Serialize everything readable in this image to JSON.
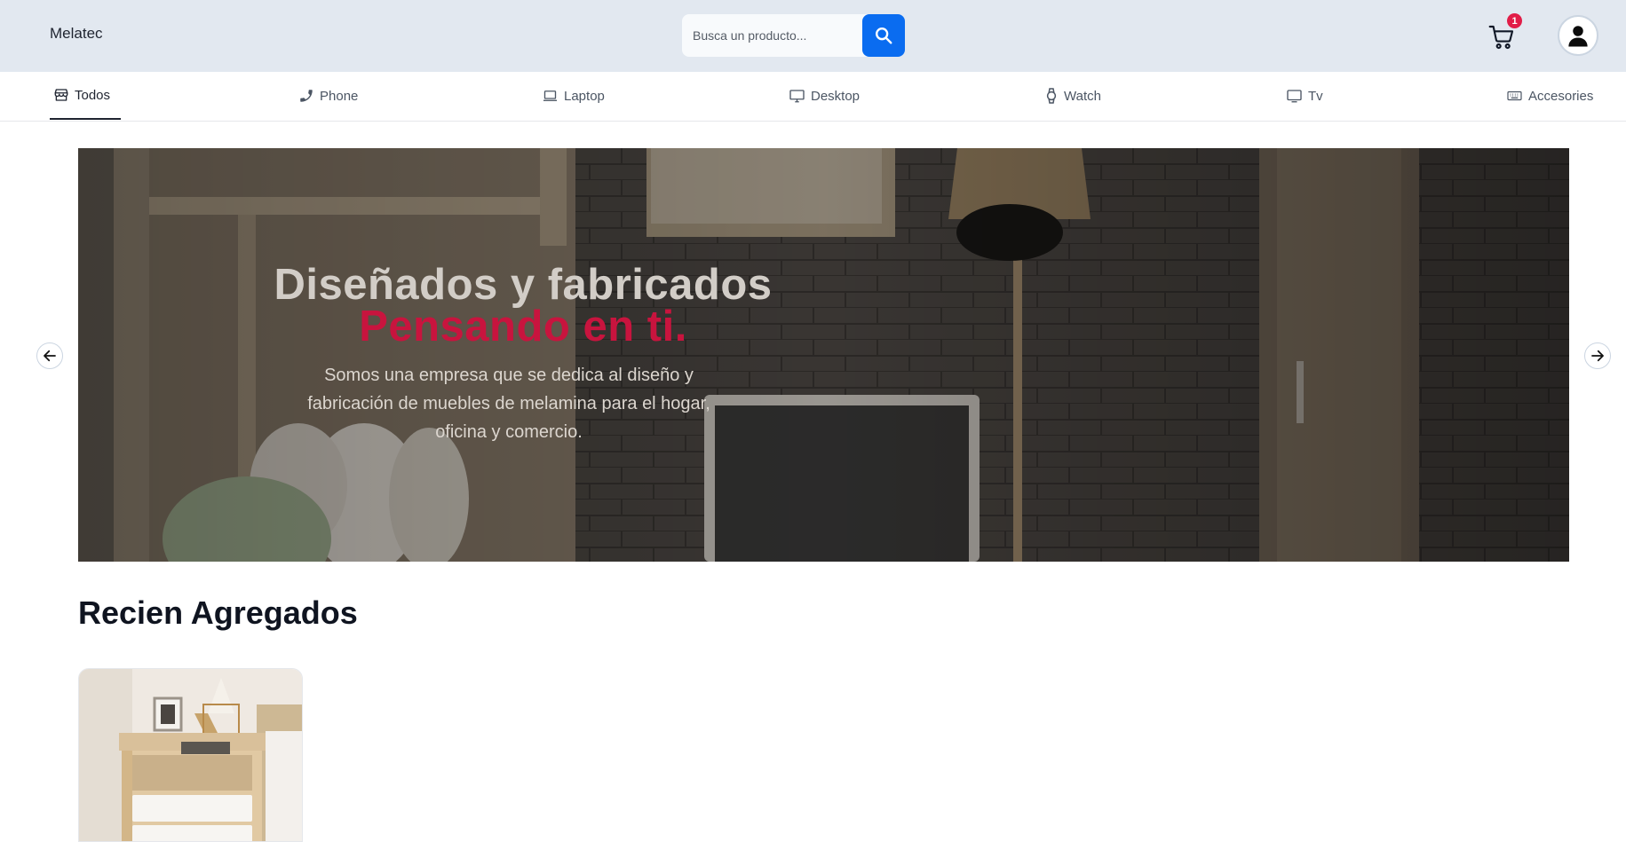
{
  "header": {
    "brand": "Melatec",
    "search": {
      "placeholder": "Busca un producto..."
    },
    "cart": {
      "count": "1"
    }
  },
  "categories": [
    {
      "label": "Todos",
      "icon": "store-icon",
      "active": true
    },
    {
      "label": "Phone",
      "icon": "phone-icon",
      "active": false
    },
    {
      "label": "Laptop",
      "icon": "laptop-icon",
      "active": false
    },
    {
      "label": "Desktop",
      "icon": "desktop-icon",
      "active": false
    },
    {
      "label": "Watch",
      "icon": "watch-icon",
      "active": false
    },
    {
      "label": "Tv",
      "icon": "tv-icon",
      "active": false
    },
    {
      "label": "Accesories",
      "icon": "keyboard-icon",
      "active": false
    }
  ],
  "hero": {
    "title_line1": "Diseñados y fabricados",
    "title_line2": "Pensando en ti.",
    "description": "Somos una empresa que se dedica al diseño y fabricación de muebles de melamina para el hogar, oficina y comercio."
  },
  "recent": {
    "title": "Recien Agregados"
  },
  "colors": {
    "header_bg": "#e2e8f0",
    "accent_blue": "#0a6cf0",
    "accent_red": "#c8143e",
    "badge_red": "#e11d48"
  }
}
